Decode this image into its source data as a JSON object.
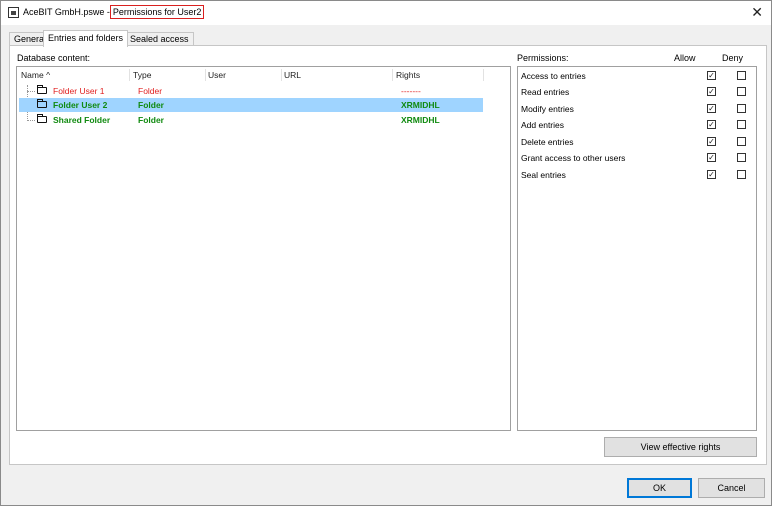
{
  "window": {
    "file_name": "AceBIT GmbH.pswe",
    "separator": "-",
    "title_highlight": "Permissions for User2",
    "close_glyph": "✕"
  },
  "tabs": [
    {
      "label": "General",
      "active": false
    },
    {
      "label": "Entries and folders",
      "active": true
    },
    {
      "label": "Sealed access",
      "active": false
    }
  ],
  "database": {
    "label": "Database content:",
    "columns": [
      "Name",
      "Type",
      "User",
      "URL",
      "Rights"
    ],
    "sort_glyph": "^",
    "rows": [
      {
        "name": "Folder User 1",
        "type": "Folder",
        "user": "",
        "url": "",
        "rights": "-------",
        "color": "#e02020",
        "bold": false,
        "selected": false
      },
      {
        "name": "Folder User 2",
        "type": "Folder",
        "user": "",
        "url": "",
        "rights": "XRMIDHL",
        "color": "#108a10",
        "bold": true,
        "selected": true
      },
      {
        "name": "Shared Folder",
        "type": "Folder",
        "user": "",
        "url": "",
        "rights": "XRMIDHL",
        "color": "#108a10",
        "bold": true,
        "selected": false
      }
    ]
  },
  "permissions": {
    "label": "Permissions:",
    "allow_header": "Allow",
    "deny_header": "Deny",
    "check_glyph": "✓",
    "items": [
      {
        "label": "Access to entries",
        "allow": true,
        "deny": false
      },
      {
        "label": "Read entries",
        "allow": true,
        "deny": false
      },
      {
        "label": "Modify entries",
        "allow": true,
        "deny": false
      },
      {
        "label": "Add entries",
        "allow": true,
        "deny": false
      },
      {
        "label": "Delete entries",
        "allow": true,
        "deny": false
      },
      {
        "label": "Grant access to other users",
        "allow": true,
        "deny": false
      },
      {
        "label": "Seal entries",
        "allow": true,
        "deny": false
      }
    ]
  },
  "buttons": {
    "view_rights": "View effective rights",
    "ok": "OK",
    "cancel": "Cancel"
  }
}
